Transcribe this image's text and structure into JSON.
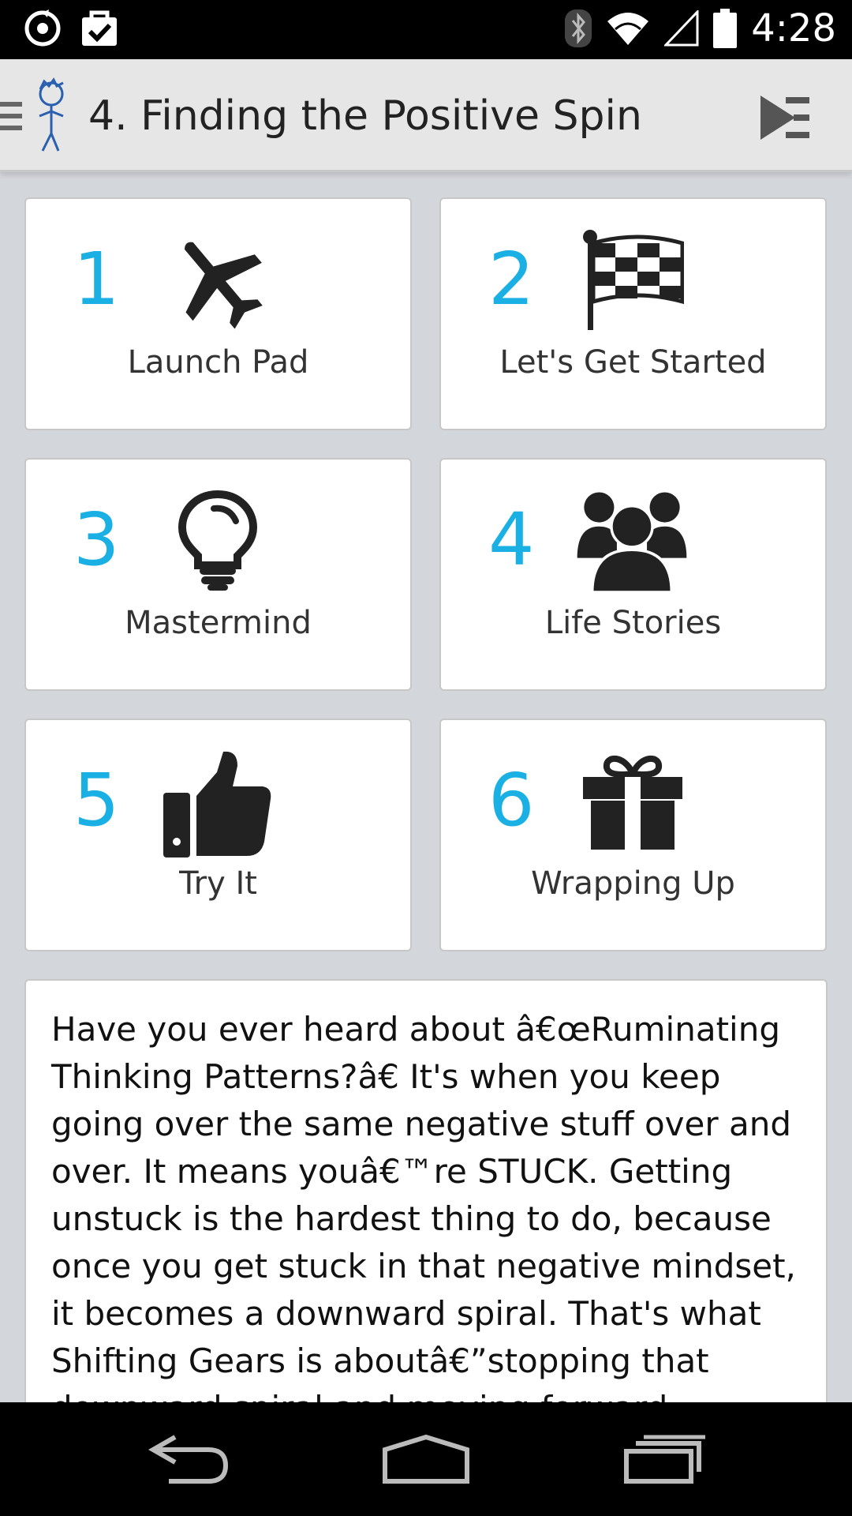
{
  "status_bar": {
    "time": "4:28",
    "icons": [
      "sync-icon",
      "task-check-icon",
      "bluetooth-icon",
      "wifi-icon",
      "cell-signal-icon",
      "battery-icon"
    ]
  },
  "action_bar": {
    "title": "4. Finding the Positive Spin",
    "icons": [
      "drawer-icon",
      "app-logo-icon",
      "next-icon"
    ]
  },
  "tiles": [
    {
      "number": "1",
      "label": "Launch Pad",
      "icon": "airplane-icon"
    },
    {
      "number": "2",
      "label": "Let's Get Started",
      "icon": "checkered-flag-icon"
    },
    {
      "number": "3",
      "label": "Mastermind",
      "icon": "lightbulb-icon"
    },
    {
      "number": "4",
      "label": "Life Stories",
      "icon": "people-icon"
    },
    {
      "number": "5",
      "label": "Try It",
      "icon": "thumbs-up-icon"
    },
    {
      "number": "6",
      "label": "Wrapping Up",
      "icon": "gift-icon"
    }
  ],
  "description": "Have you ever heard about â€œRuminating Thinking Patterns?â€ It's when you keep going over the same negative stuff over and over. It means youâ€™re STUCK. Getting unstuck is the hardest thing to do, because once you get stuck in that negative mindset, it becomes a downward spiral. That's what Shifting Gears is aboutâ€”stopping that downward spiral and moving forward.",
  "colors": {
    "accent": "#1ab0e4",
    "background": "#d3d6db",
    "action_bar": "#e6e6e6"
  },
  "nav_bar": {
    "icons": [
      "back-icon",
      "home-icon",
      "recents-icon"
    ]
  }
}
